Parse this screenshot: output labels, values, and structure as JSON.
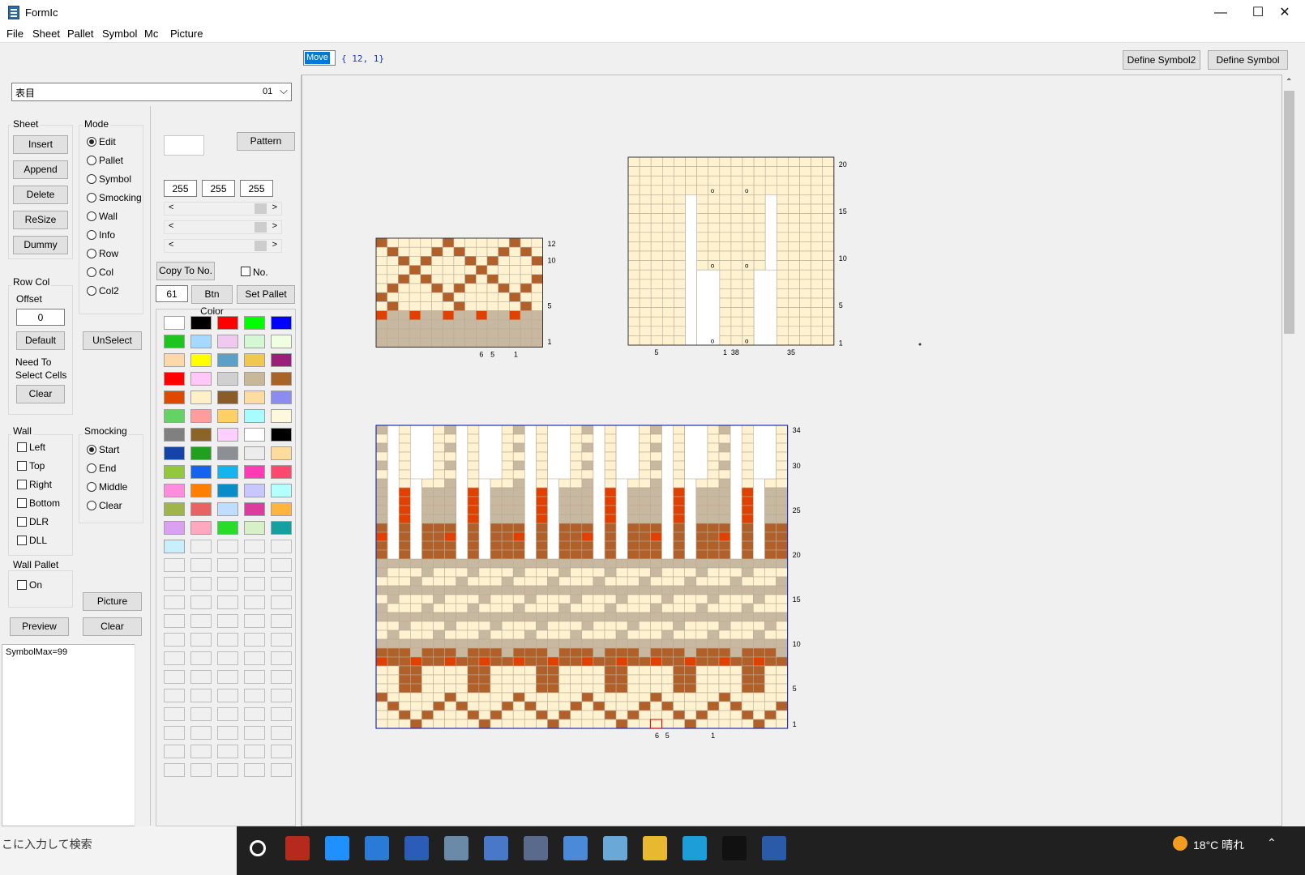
{
  "window": {
    "title": "FormIc",
    "minimize_glyph": "—",
    "maximize_glyph": "☐",
    "close_glyph": "✕"
  },
  "menu": [
    "File",
    "Sheet",
    "Pallet",
    "Symbol",
    "Mc",
    "Picture"
  ],
  "toolbar": {
    "move_value": "Move",
    "coord_text": "{ 12,  1}",
    "define_symbol2": "Define Symbol2",
    "define_symbol": "Define Symbol"
  },
  "sheet_select": {
    "value": "表目",
    "number": "01"
  },
  "sheet_group": {
    "label": "Sheet",
    "buttons": [
      "Insert",
      "Append",
      "Delete",
      "ReSize",
      "Dummy"
    ]
  },
  "mode_group": {
    "label": "Mode",
    "options": [
      "Edit",
      "Pallet",
      "Symbol",
      "Smocking",
      "Wall",
      "Info",
      "Row",
      "Col",
      "Col2"
    ],
    "selected": "Edit"
  },
  "rowcol_group": {
    "label": "Row Col",
    "offset_label": "Offset",
    "offset_value": "0",
    "default_label": "Default",
    "need_to_line1": "Need To",
    "need_to_line2": "Select Cells",
    "clear_label": "Clear"
  },
  "unselect_label": "UnSelect",
  "wall_group": {
    "label": "Wall",
    "options": [
      "Left",
      "Top",
      "Right",
      "Bottom",
      "DLR",
      "DLL"
    ]
  },
  "smocking_group": {
    "label": "Smocking",
    "options": [
      "Start",
      "End",
      "Middle",
      "Clear"
    ],
    "selected": "Start"
  },
  "wall_pallet_group": {
    "label": "Wall Pallet",
    "on_label": "On"
  },
  "bottom_buttons": {
    "picture": "Picture",
    "preview": "Preview",
    "clear": "Clear"
  },
  "symbol_info": "SymbolMax=99",
  "pallet_panel": {
    "pattern_label": "Pattern",
    "rgb": [
      "255",
      "255",
      "255"
    ],
    "copy_to_label": "Copy To No.",
    "no_label": "No.",
    "index_value": "61",
    "btn_color_label": "Btn Color",
    "set_pallet_label": "Set Pallet",
    "colors": [
      "#ffffff",
      "#000000",
      "#ff0000",
      "#00ff00",
      "#0000ff",
      "#1fc41f",
      "#a8d8ff",
      "#f0c8f0",
      "#d4f8d4",
      "#f0ffe0",
      "#ffd8a8",
      "#ffff00",
      "#5aa0c8",
      "#f0c850",
      "#9a1e7a",
      "#ff0000",
      "#ffc8f8",
      "#d0d0d0",
      "#c8b898",
      "#a86428",
      "#e04800",
      "#fff0c8",
      "#8c5c28",
      "#ffdca0",
      "#8c8cf0",
      "#64d264",
      "#ff9c9c",
      "#ffd064",
      "#a8fcff",
      "#fff8dc",
      "#808080",
      "#8c6428",
      "#ffd0ff",
      "#ffffff",
      "#000000",
      "#1444a8",
      "#1fa01f",
      "#8c9094",
      "#ececec",
      "#ffdc9c",
      "#94c83c",
      "#1464f0",
      "#14b4f0",
      "#ff3cb4",
      "#ff4870",
      "#ff8cdc",
      "#ff8000",
      "#0a8cc8",
      "#c8c8ff",
      "#b4ffff",
      "#a0b44c",
      "#e86464",
      "#c0dcff",
      "#dc3c9c",
      "#ffb43c",
      "#dca0f0",
      "#ffa8c0",
      "#28dc28",
      "#d8f0c8",
      "#14a0a0",
      "#c8f0fc"
    ],
    "empty_slots": 64
  },
  "canvas": {
    "chart1": {
      "row_labels": [
        "12",
        "10",
        "5",
        "1"
      ],
      "col_labels": [
        "6",
        "5",
        "1"
      ]
    },
    "chart2": {
      "row_labels": [
        "20",
        "15",
        "10",
        "5",
        "1"
      ],
      "col_labels": [
        "5",
        "1",
        "38",
        "35"
      ]
    },
    "chart3": {
      "row_labels": [
        "34",
        "30",
        "25",
        "20",
        "15",
        "10",
        "5",
        "1"
      ],
      "col_labels": [
        "6",
        "5",
        "1"
      ]
    }
  },
  "taskbar": {
    "search_text": "こに入力して検索",
    "weather": "18°C  晴れ",
    "icons": [
      "cortana-icon",
      "pdf-app-icon",
      "mail-icon",
      "vscode-icon",
      "word-icon",
      "photos-app-icon",
      "devices-app-icon",
      "calculator-icon",
      "paint-icon",
      "notepad-icon",
      "file-explorer-icon",
      "edge-icon",
      "terminal-icon",
      "formic-app-icon"
    ]
  },
  "colors": {
    "cream": "#fff2d0",
    "beige": "#c8b8a0",
    "brown": "#b06028",
    "red": "#e04000",
    "grid": "#b8ac98",
    "selection_blue": "#2030b0"
  }
}
